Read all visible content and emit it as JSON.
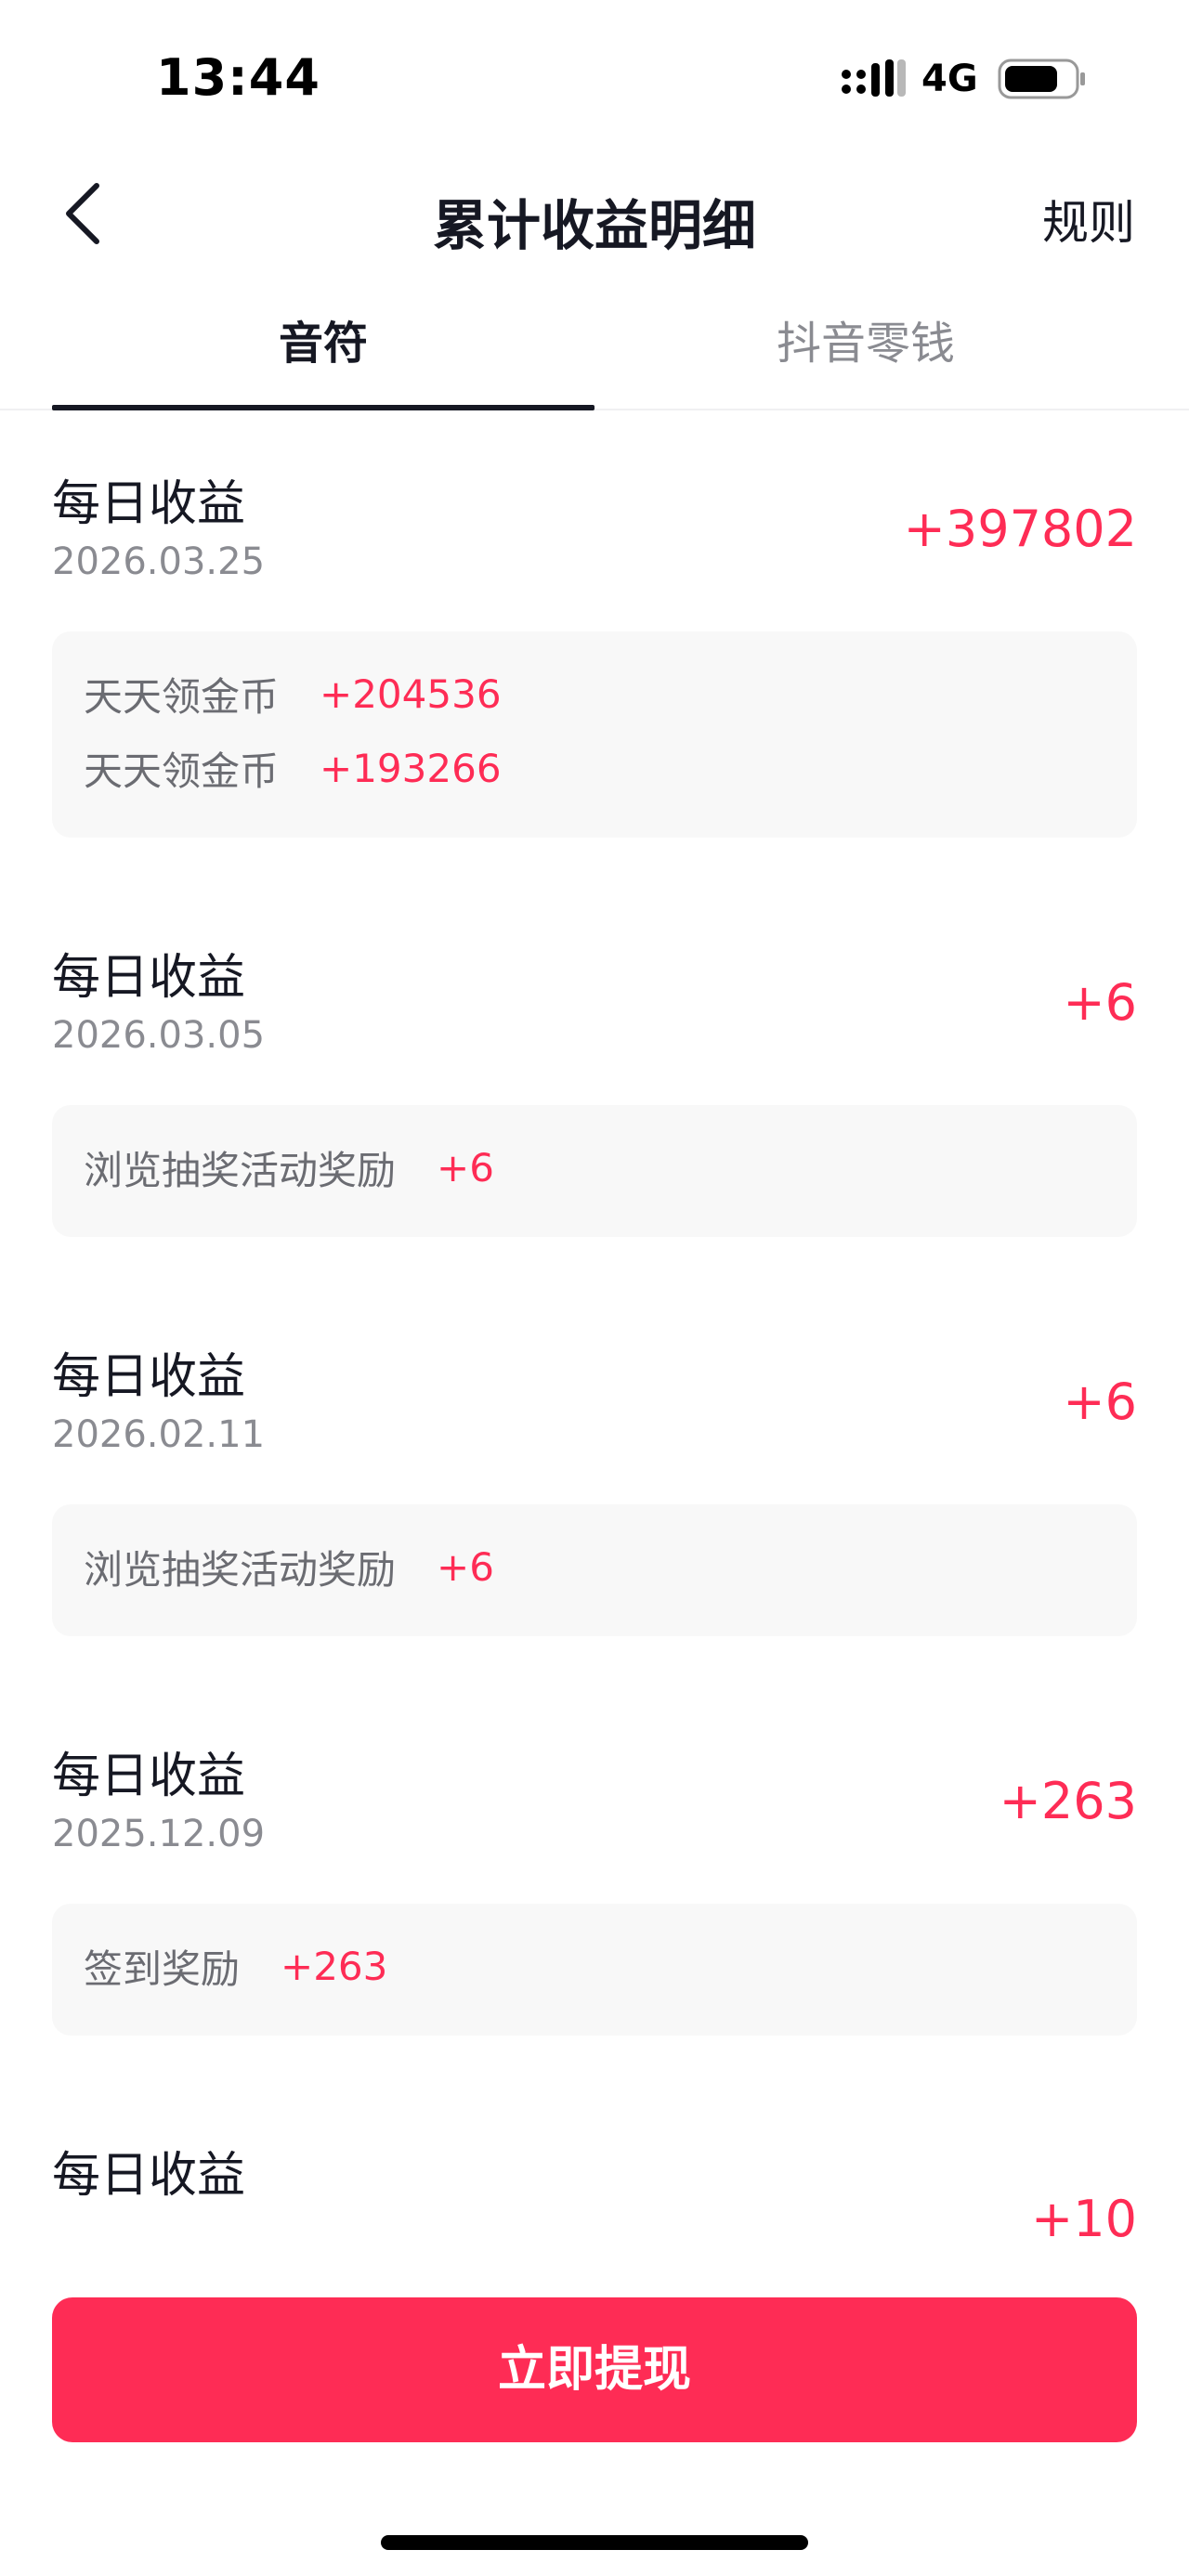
{
  "status_bar": {
    "time": "13:44",
    "network": "4G"
  },
  "nav": {
    "title": "累计收益明细",
    "rules_label": "规则"
  },
  "tabs": [
    {
      "label": "音符",
      "active": true
    },
    {
      "label": "抖音零钱",
      "active": false
    }
  ],
  "entries": [
    {
      "title": "每日收益",
      "date": "2026.03.25",
      "total": "+397802",
      "details": [
        {
          "label": "天天领金币",
          "amount": "+204536"
        },
        {
          "label": "天天领金币",
          "amount": "+193266"
        }
      ]
    },
    {
      "title": "每日收益",
      "date": "2026.03.05",
      "total": "+6",
      "details": [
        {
          "label": "浏览抽奖活动奖励",
          "amount": "+6"
        }
      ]
    },
    {
      "title": "每日收益",
      "date": "2026.02.11",
      "total": "+6",
      "details": [
        {
          "label": "浏览抽奖活动奖励",
          "amount": "+6"
        }
      ]
    },
    {
      "title": "每日收益",
      "date": "2025.12.09",
      "total": "+263",
      "details": [
        {
          "label": "签到奖励",
          "amount": "+263"
        }
      ]
    },
    {
      "title": "每日收益",
      "date": "",
      "total": "+10",
      "details": []
    }
  ],
  "withdraw_button": {
    "label": "立即提现"
  },
  "colors": {
    "accent": "#fe2c55",
    "text_primary": "#161823",
    "text_secondary": "#8a8b91",
    "detail_bg": "#f8f8f8"
  },
  "icons": {
    "back": "back-chevron-icon",
    "signal": "signal-icon",
    "battery": "battery-icon"
  }
}
